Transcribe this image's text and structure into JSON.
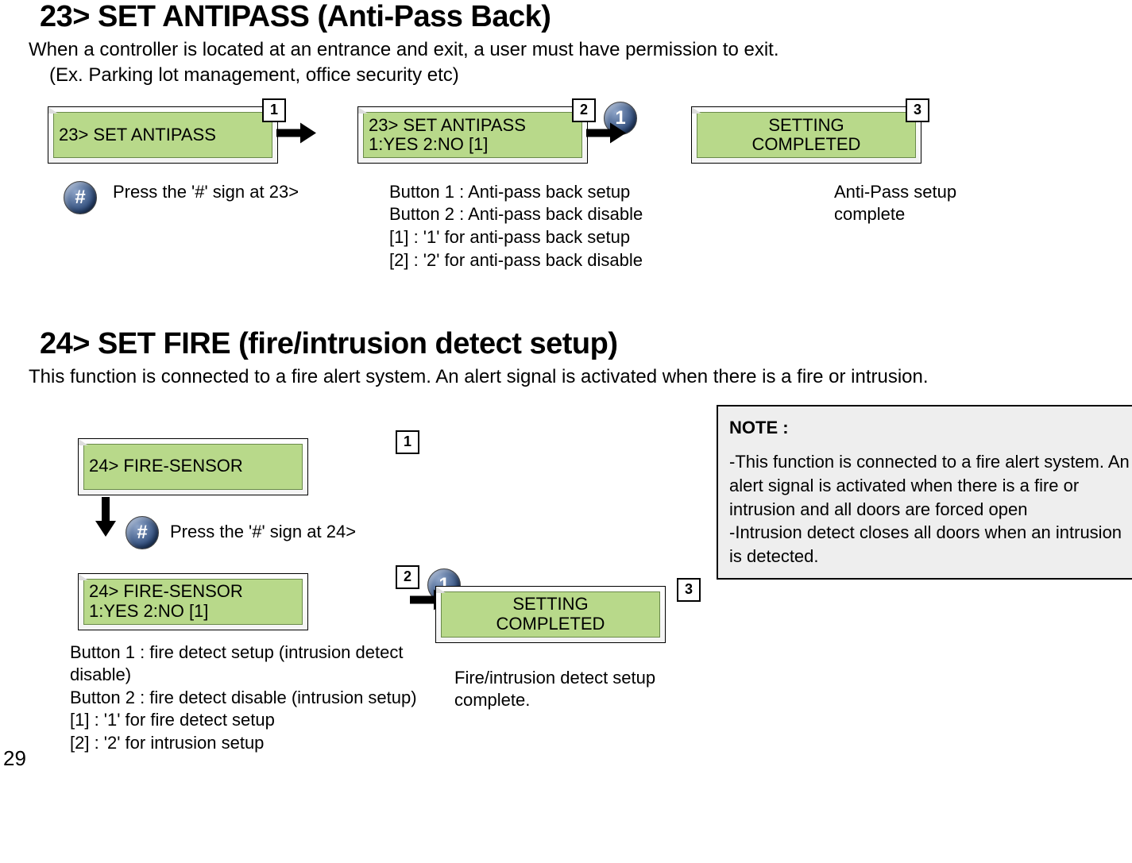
{
  "page_number": "29",
  "section23": {
    "title": "23> SET ANTIPASS (Anti-Pass Back)",
    "intro_line1": "When a controller is located at an entrance and exit, a user must have permission to exit.",
    "intro_line2": "(Ex. Parking lot management, office security etc)",
    "step1": {
      "badge": "1",
      "lcd": "23> SET ANTIPASS"
    },
    "step1_caption": "Press the '#' sign at 23>",
    "hash_key": "#",
    "step2": {
      "badge": "2",
      "lcd_line1": "23>  SET ANTIPASS",
      "lcd_line2": " 1:YES   2:NO  [1]"
    },
    "one_key": "1",
    "step2_caption": "Button 1 : Anti-pass back setup\nButton 2 : Anti-pass back disable\n[1] : '1' for anti-pass back setup\n[2] : '2' for anti-pass back disable",
    "step3": {
      "badge": "3",
      "lcd_line1": "SETTING",
      "lcd_line2": "COMPLETED"
    },
    "step3_caption": "Anti-Pass setup complete"
  },
  "section24": {
    "title": "24> SET FIRE (fire/intrusion detect setup)",
    "intro": "This function is connected to a fire alert system. An alert signal is activated when there is a fire or intrusion.",
    "note_title": "NOTE :",
    "note_body": "-This function is connected to a fire alert system. An alert signal is activated when there is a fire or intrusion and all doors are forced open\n-Intrusion detect closes all doors when an intrusion is detected.",
    "step1": {
      "badge": "1",
      "lcd": "24> FIRE-SENSOR"
    },
    "step1_caption": "Press the '#' sign at 24>",
    "hash_key": "#",
    "step2": {
      "badge": "2",
      "lcd_line1": "24>  FIRE-SENSOR",
      "lcd_line2": " 1:YES   2:NO  [1]"
    },
    "one_key": "1",
    "step2_caption": " Button 1 : fire detect setup (intrusion detect disable)\n Button 2 : fire detect disable (intrusion setup)\n [1] : '1' for fire detect setup\n [2] : '2' for intrusion setup",
    "step3": {
      "badge": "3",
      "lcd_line1": "SETTING",
      "lcd_line2": "COMPLETED"
    },
    "step3_caption": "Fire/intrusion detect setup complete."
  }
}
